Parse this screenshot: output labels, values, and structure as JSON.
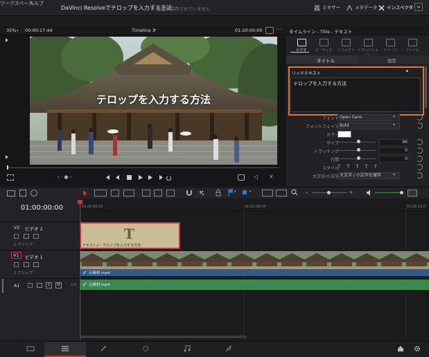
{
  "menu": [
    "ワークスペース",
    "ヘルプ"
  ],
  "window": {
    "title": "DaVinci Resolveでテロップを入力する方法",
    "unsaved": "変更が保存されていません"
  },
  "topbuttons": {
    "mixer": "ミキサー",
    "metadata": "メタデータ",
    "inspector": "インスペクタ"
  },
  "viewer": {
    "zoom": "35%",
    "source_tc": "00:00:17:44",
    "timeline_name": "Timeline 1",
    "timeline_tc": "01:20:00:00",
    "overlay_text": "テロップを入力する方法"
  },
  "inspector": {
    "header": "タイムライン - Title - テキスト",
    "tabs": [
      "ビデオ",
      "オーディオ",
      "エフェクト",
      "トランジション",
      "イメージ",
      "ファイル"
    ],
    "subtabs": [
      "タイトル",
      "設定"
    ],
    "rich_text_label": "リッチテキスト",
    "text_content": "テロップを入力する方法",
    "font_label": "フォント",
    "font_value": "Open Sans",
    "face_label": "フォントフェイス",
    "face_value": "Bold",
    "color_label": "カラー",
    "size_label": "サイズ",
    "size_value": "96",
    "tracking_label": "トラッキング",
    "tracking_value": "0",
    "leading_label": "行間",
    "leading_value": "0",
    "style_label": "スタイル",
    "case_label": "大文字/小文字",
    "case_value": "大文字 / 小文字を保存",
    "accent": "#e8772e"
  },
  "timeline": {
    "timecode": "01:00:00:00",
    "ruler": [
      "01:00:00:00",
      "01:00:08:00",
      "01:00:16:0"
    ],
    "tracks": [
      {
        "id": "V2",
        "name": "ビデオ 2",
        "clips": "1 クリップ"
      },
      {
        "id": "V1",
        "name": "ビデオ 1",
        "clips": "1 クリップ"
      },
      {
        "id": "A1",
        "name": "",
        "level": "2.0"
      }
    ],
    "title_clip_label": "テキスト+ - テロップを入力する方法",
    "video_clip_label": "元素材.mp4",
    "audio_clip_label": "元素材.mp4"
  },
  "pages": [
    "media",
    "cut",
    "edit",
    "fusion",
    "color",
    "fairlight",
    "deliver"
  ]
}
